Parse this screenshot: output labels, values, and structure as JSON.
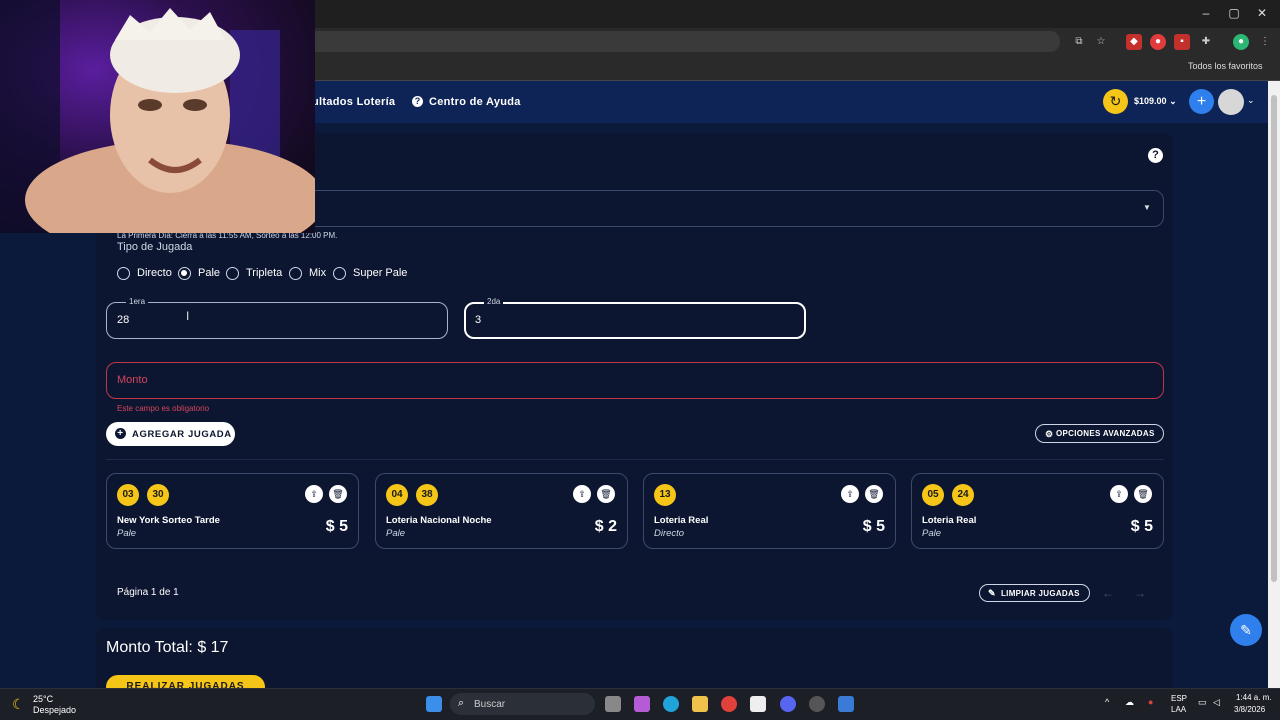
{
  "browser": {
    "favorites_label": "Todos los favoritos",
    "window_controls": [
      "–",
      "▢",
      "✕"
    ]
  },
  "nav": {
    "links": [
      {
        "label": "ultados Lotería"
      },
      {
        "label": "Centro de Ayuda",
        "icon": "help-circle-icon"
      }
    ],
    "balance": "$109.00",
    "balance_caret": "⌄",
    "plus_label": "+",
    "avatar_caret": "⌄"
  },
  "form": {
    "schedule_note": "La Primera Día: Cierra a las 11:55 AM, Sorteo a las 12:00 PM.",
    "tipo_label": "Tipo de Jugada",
    "play_types": [
      {
        "label": "Directo",
        "selected": false
      },
      {
        "label": "Pale",
        "selected": true
      },
      {
        "label": "Tripleta",
        "selected": false
      },
      {
        "label": "Mix",
        "selected": false
      },
      {
        "label": "Super Pale",
        "selected": false
      }
    ],
    "first_label": "1era",
    "first_value": "28",
    "second_label": "2da",
    "second_value": "3",
    "monto_placeholder": "Monto",
    "monto_error": "Este campo es obligatorio",
    "add_button": "AGREGAR JUGADA",
    "advanced_button": "OPCIONES AVANZADAS"
  },
  "plays": [
    {
      "numbers": [
        "03",
        "30"
      ],
      "lottery": "New York Sorteo Tarde",
      "type": "Pale",
      "amount": "$ 5"
    },
    {
      "numbers": [
        "04",
        "38"
      ],
      "lottery": "Loteria Nacional Noche",
      "type": "Pale",
      "amount": "$ 2"
    },
    {
      "numbers": [
        "13"
      ],
      "lottery": "Loteria Real",
      "type": "Directo",
      "amount": "$ 5"
    },
    {
      "numbers": [
        "05",
        "24"
      ],
      "lottery": "Loteria Real",
      "type": "Pale",
      "amount": "$ 5"
    }
  ],
  "pagination": {
    "label": "Página 1 de 1",
    "clear_button": "LIMPIAR JUGADAS"
  },
  "total": {
    "label": "Monto Total: $ 17",
    "submit_button": "REALIZAR JUGADAS"
  },
  "taskbar": {
    "weather_temp": "25°C",
    "weather_desc": "Despejado",
    "search_placeholder": "Buscar",
    "lang_top": "ESP",
    "lang_bottom": "LAA",
    "time": "1:44 a. m.",
    "date": "3/8/2026"
  },
  "colors": {
    "accent_yellow": "#f5c518",
    "accent_blue": "#2f80ed",
    "error_red": "#d3455b",
    "panel": "#0d1630",
    "background": "#0b1a3b"
  }
}
